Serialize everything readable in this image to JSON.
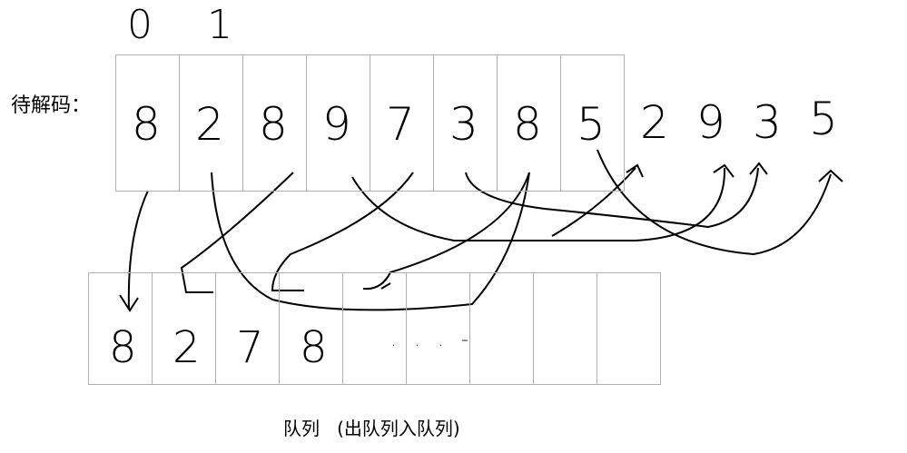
{
  "header_digits": [
    "0",
    "1"
  ],
  "to_decode_label": "待解码：",
  "top_row": [
    "8",
    "2",
    "8",
    "9",
    "7",
    "3",
    "8",
    "5"
  ],
  "appended": [
    "2",
    "9",
    "3",
    "5"
  ],
  "queue_row": [
    "8",
    "2",
    "7",
    "8",
    "",
    "",
    "",
    "",
    ""
  ],
  "queue_dots": ". . . -",
  "queue_label": "队列   (出队列入队列)"
}
